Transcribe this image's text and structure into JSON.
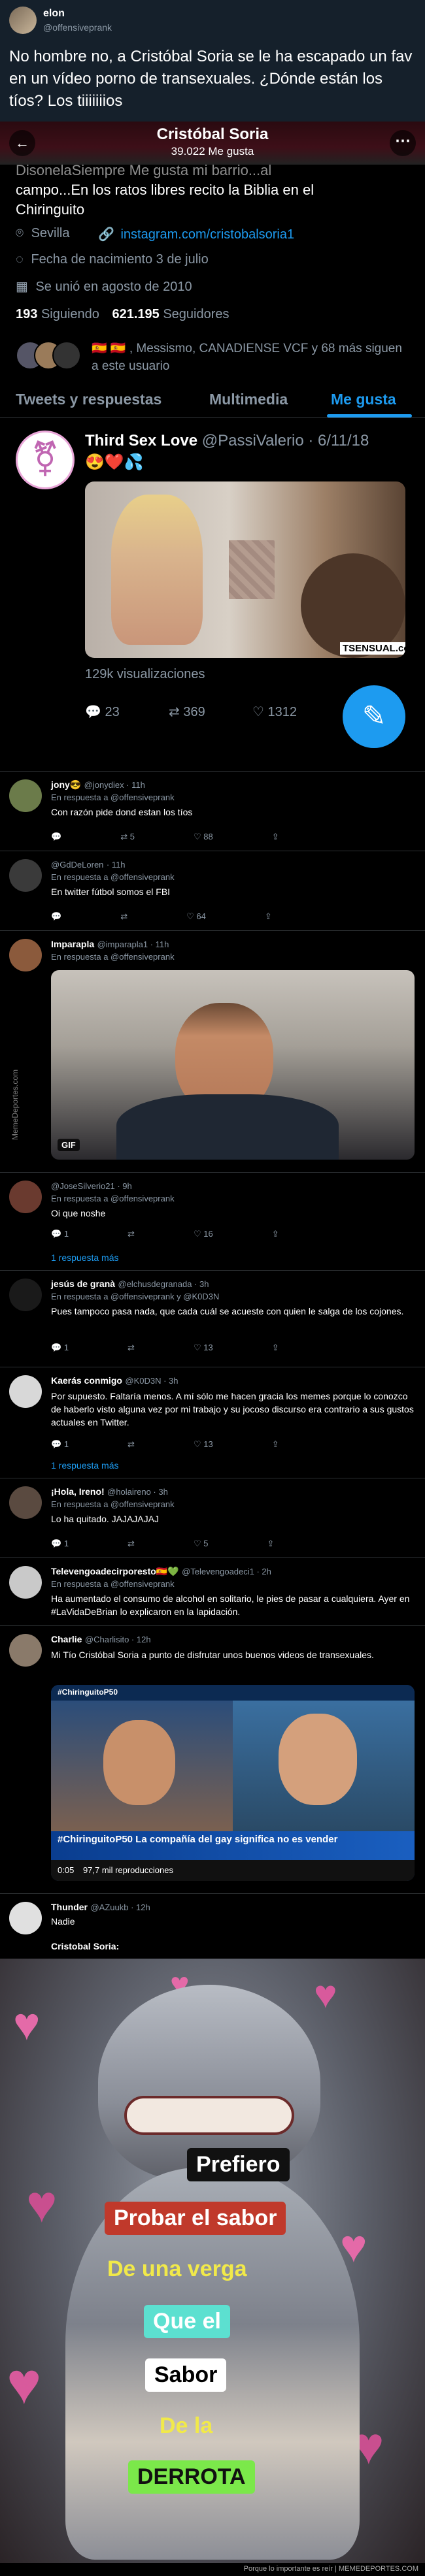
{
  "top_tweet": {
    "name": "elon",
    "handle": "@offensiveprank",
    "text": "No hombre no, a Cristóbal Soria se le ha escapado un fav en un vídeo porno de transexuales. ¿Dónde están los tíos? Los tiiiiiiios"
  },
  "profile": {
    "header_name": "Cristóbal Soria",
    "header_likes": "39.022 Me gusta",
    "bio_line1": "DisonelaSiempre Me gusta mi barrio...al",
    "bio_line2": "campo...En los ratos libres recito la Biblia en el",
    "bio_line3": "Chiringuito",
    "location": "Sevilla",
    "website": "instagram.com/cristobalsoria1",
    "birth": "Fecha de nacimiento 3 de julio",
    "joined": "Se unió en agosto de 2010",
    "following_count": "193",
    "following_label": "Siguiendo",
    "followers_count": "621.195",
    "followers_label": "Seguidores",
    "followed_by": "🇪🇸 🇪🇸 , Messismo, CANADIENSE VCF y 68 más siguen a este usuario",
    "tabs": [
      "Tweets y respuestas",
      "Multimedia",
      "Me gusta"
    ],
    "liked": {
      "name": "Third Sex Love",
      "handle": "@PassiValerio",
      "date": "· 6/11/18",
      "emojis": "😍❤️💦",
      "watermark": "TSENSUAL.com",
      "views": "129k visualizaciones",
      "replies": "23",
      "retweets": "369",
      "likes": "1312"
    }
  },
  "replies": [
    {
      "name": "jony😎",
      "handle": "@jonydiex · 11h",
      "reply_to": "En respuesta a @offensiveprank",
      "text": "Con razón  pide dond estan los tíos",
      "retweets": "5",
      "likes": "88",
      "replies": ""
    },
    {
      "name": "@GdDeLoren",
      "handle": "· 11h",
      "reply_to": "En respuesta a @offensiveprank",
      "text": "En twitter fútbol somos el FBI",
      "retweets": "",
      "likes": "64",
      "replies": ""
    },
    {
      "name": "Imparapla",
      "handle": "@imparapla1 · 11h",
      "reply_to": "En respuesta a @offensiveprank",
      "text": "",
      "gif": "GIF",
      "retweets": "",
      "likes": "",
      "replies": ""
    },
    {
      "name": "",
      "handle": "@JoseSilverio21 · 9h",
      "reply_to": "En respuesta a @offensiveprank",
      "text": "Oi que noshe",
      "retweets": "",
      "likes": "16",
      "replies": "1",
      "thread": "1 respuesta más"
    },
    {
      "name": "jesús de granà",
      "handle": "@elchusdegranada · 3h",
      "reply_to": "En respuesta a @offensiveprank y @K0D3N",
      "text": "Pues tampoco pasa nada, que cada cuál se acueste con quien le salga de los cojones.",
      "retweets": "",
      "likes": "13",
      "replies": "1"
    },
    {
      "name": "Kaerás conmigo",
      "handle": "@K0D3N · 3h",
      "reply_to": "",
      "text": "Por supuesto. Faltaría menos. A mí sólo me hacen gracia los memes porque lo conozco de haberlo visto alguna vez por mi trabajo y su jocoso discurso era contrario a sus gustos actuales en Twitter.",
      "retweets": "",
      "likes": "13",
      "replies": "1",
      "thread": "1 respuesta más"
    },
    {
      "name": "¡Hola, Ireno!",
      "handle": "@holaireno · 3h",
      "reply_to": "En respuesta a @offensiveprank",
      "text": "Lo ha quitado. JAJAJAJAJ",
      "retweets": "",
      "likes": "5",
      "replies": "1"
    },
    {
      "name": "Televengoadecirporesto🇪🇸💚",
      "handle": "@Televengoadeci1 · 2h",
      "reply_to": "En respuesta a @offensiveprank",
      "text": "Ha aumentado el consumo de alcohol en solitario, le pies de pasar a cualquiera. Ayer en #LaVidaDeBrian lo explicaron en la lapidación.",
      "retweets": "",
      "likes": "",
      "replies": ""
    },
    {
      "name": "Charlie",
      "handle": "@Charlisito · 12h",
      "reply_to": "",
      "text": "Mi Tío Cristóbal Soria a punto de disfrutar unos buenos videos de transexuales.",
      "video_tag": "#ChiringuitoP50",
      "video_caption": "#ChiringuitoP50 La compañía del gay significa no es vender",
      "video_time": "0:05",
      "video_views": "97,7 mil reproducciones",
      "retweets": "",
      "likes": "",
      "replies": ""
    },
    {
      "name": "Thunder",
      "handle": "@AZuukb · 12h",
      "reply_to": "",
      "text": "Nadie",
      "text2": "Cristobal Soria:",
      "retweets": "",
      "likes": "",
      "replies": ""
    }
  ],
  "meme": {
    "labels": [
      "Prefiero",
      "Probar el sabor",
      "De una verga",
      "Que el",
      "Sabor",
      "De la",
      "DERROTA"
    ],
    "side_watermark": "MemeDeportes.com",
    "footer": "Porque lo importante es reír | MEMEDEPORTES.COM"
  }
}
